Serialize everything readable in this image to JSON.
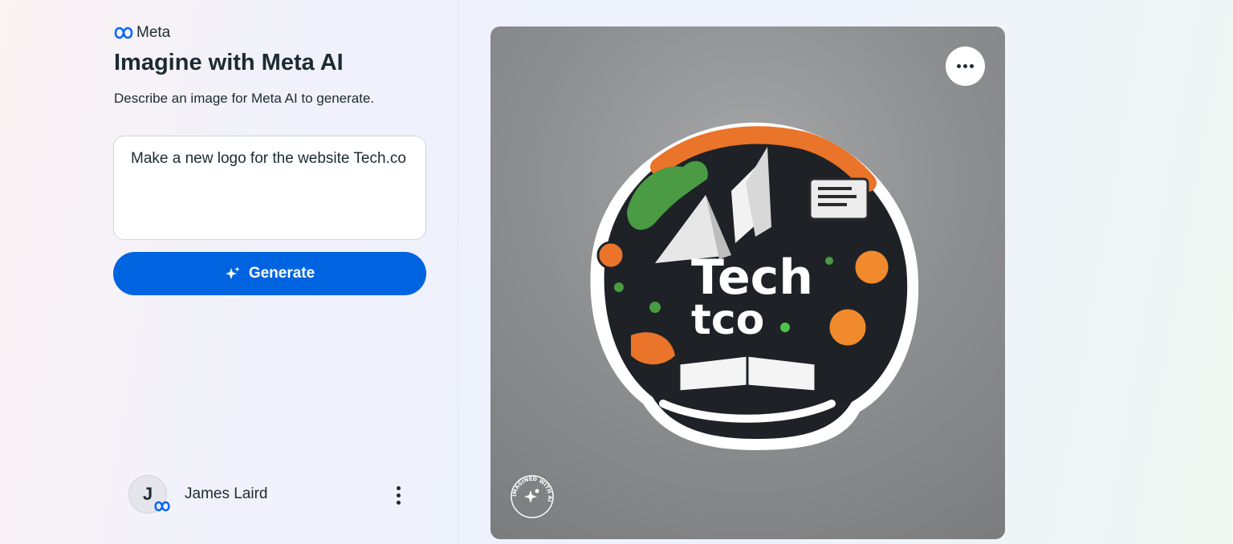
{
  "brand": {
    "name": "Meta",
    "accent": "#0064e0",
    "logo_icon": "meta-infinity-icon"
  },
  "header": {
    "title": "Imagine with Meta AI",
    "subtitle": "Describe an image for Meta AI to generate."
  },
  "prompt": {
    "value": "Make a new logo for the website Tech.co"
  },
  "generate_button": {
    "label": "Generate",
    "icon": "sparkle-icon"
  },
  "user": {
    "initial": "J",
    "name": "James Laird",
    "menu_icon": "kebab-menu-icon"
  },
  "generated_image": {
    "logo_text_line1": "Tech",
    "logo_text_line2": "tco",
    "more_icon": "more-horizontal-icon",
    "watermark_text": "IMAGINED WITH AI"
  }
}
